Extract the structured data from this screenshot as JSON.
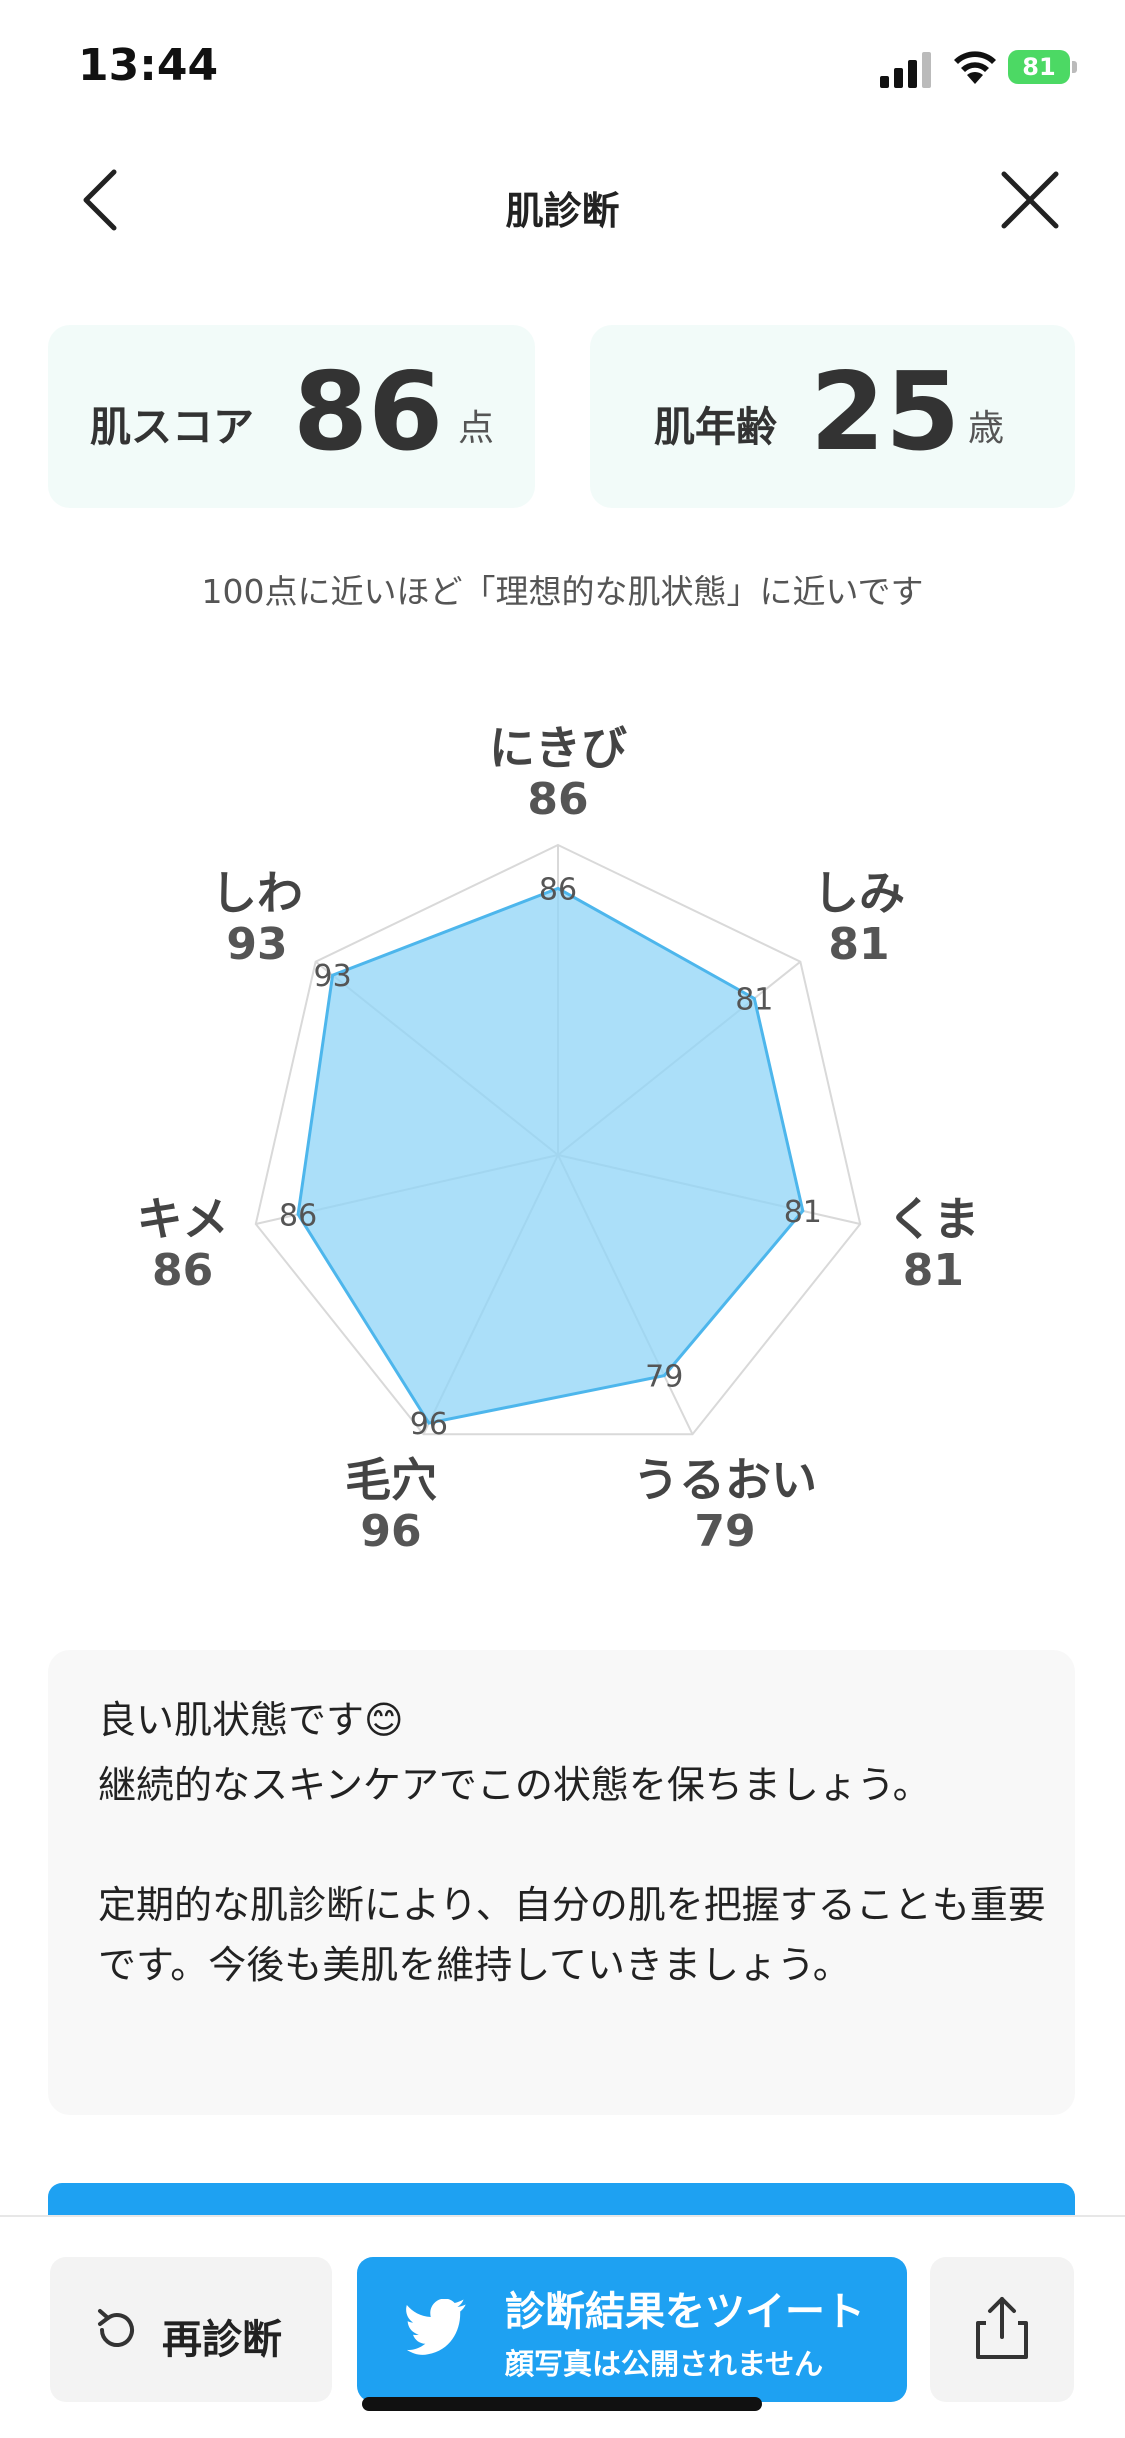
{
  "status_bar": {
    "time": "13:44",
    "battery": "81"
  },
  "nav": {
    "title": "肌診断"
  },
  "cards": {
    "skin_score": {
      "label": "肌スコア",
      "value": "86",
      "unit": "点"
    },
    "skin_age": {
      "label": "肌年齢",
      "value": "25",
      "unit": "歳"
    }
  },
  "hint": "100点に近いほど「理想的な肌状態」に近いです",
  "radar": {
    "max": 100,
    "axes": [
      {
        "name": "にきび",
        "value": 86
      },
      {
        "name": "しみ",
        "value": 81
      },
      {
        "name": "くま",
        "value": 81
      },
      {
        "name": "うるおい",
        "value": 79
      },
      {
        "name": "毛穴",
        "value": 96
      },
      {
        "name": "キメ",
        "value": 86
      },
      {
        "name": "しわ",
        "value": 93
      }
    ],
    "fill_color": "#8fd4f7",
    "stroke_color": "#4db6ec",
    "grid_color": "#d9d9d9"
  },
  "message": {
    "line1": "良い肌状態です😊",
    "line2": "継続的なスキンケアでこの状態を保ちましょう。",
    "line3": "定期的な肌診断により、自分の肌を把握することも重要です。今後も美肌を維持していきましょう。"
  },
  "bottom": {
    "retry_label": "再診断",
    "tweet_label": "診断結果をツイート",
    "tweet_sub": "顔写真は公開されません"
  },
  "colors": {
    "accent": "#1ea1f2",
    "card_bg": "#f2fbf9"
  }
}
